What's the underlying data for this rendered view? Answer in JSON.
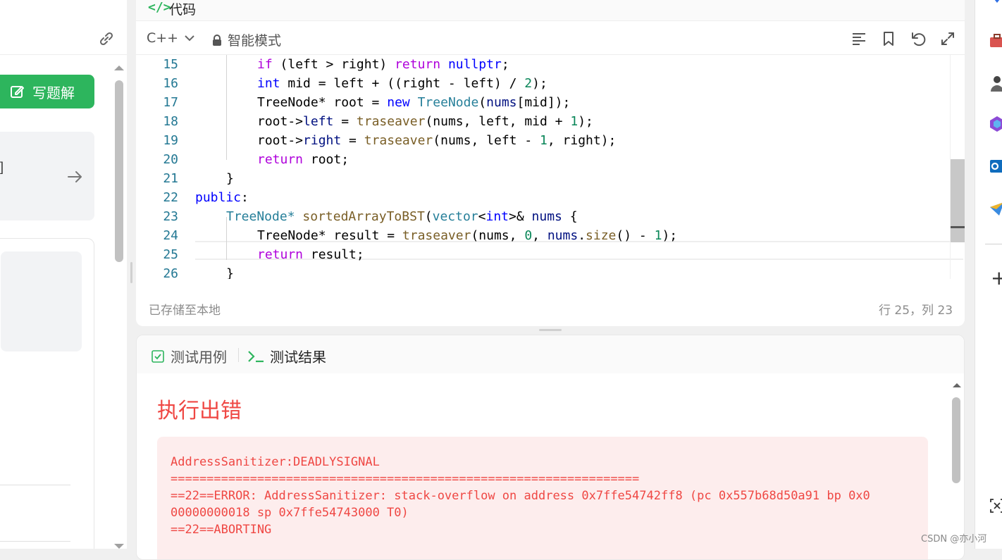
{
  "left_panel": {
    "write_solution_label": "写题解",
    "card_text": "]"
  },
  "code_panel": {
    "title_icon": "</>",
    "title": "代码",
    "language": "C++",
    "mode": "智能模式",
    "status_left": "已存储至本地",
    "status_right": "行 25，列 23",
    "line_numbers": [
      "15",
      "16",
      "17",
      "18",
      "19",
      "20",
      "21",
      "22",
      "23",
      "24",
      "25",
      "26"
    ]
  },
  "result_panel": {
    "tab_testcase": "测试用例",
    "tab_result": "测试结果",
    "error_title": "执行出错",
    "error_lines": [
      "AddressSanitizer:DEADLYSIGNAL",
      "=================================================================",
      "==22==ERROR: AddressSanitizer: stack-overflow on address 0x7ffe54742ff8 (pc 0x557b68d50a91 bp 0x0",
      "00000000018 sp 0x7ffe54743000 T0)",
      "==22==ABORTING"
    ]
  },
  "watermark": "CSDN @亦小河",
  "colors": {
    "accent_green": "#2db55d",
    "error_red": "#ef4743",
    "error_bg": "#fdeded"
  },
  "icons": [
    "link-icon",
    "edit-icon",
    "arrow-right-icon",
    "lock-icon",
    "chevron-down-icon",
    "format-icon",
    "bookmark-icon",
    "undo-icon",
    "expand-icon",
    "checkbox-icon",
    "terminal-icon"
  ]
}
